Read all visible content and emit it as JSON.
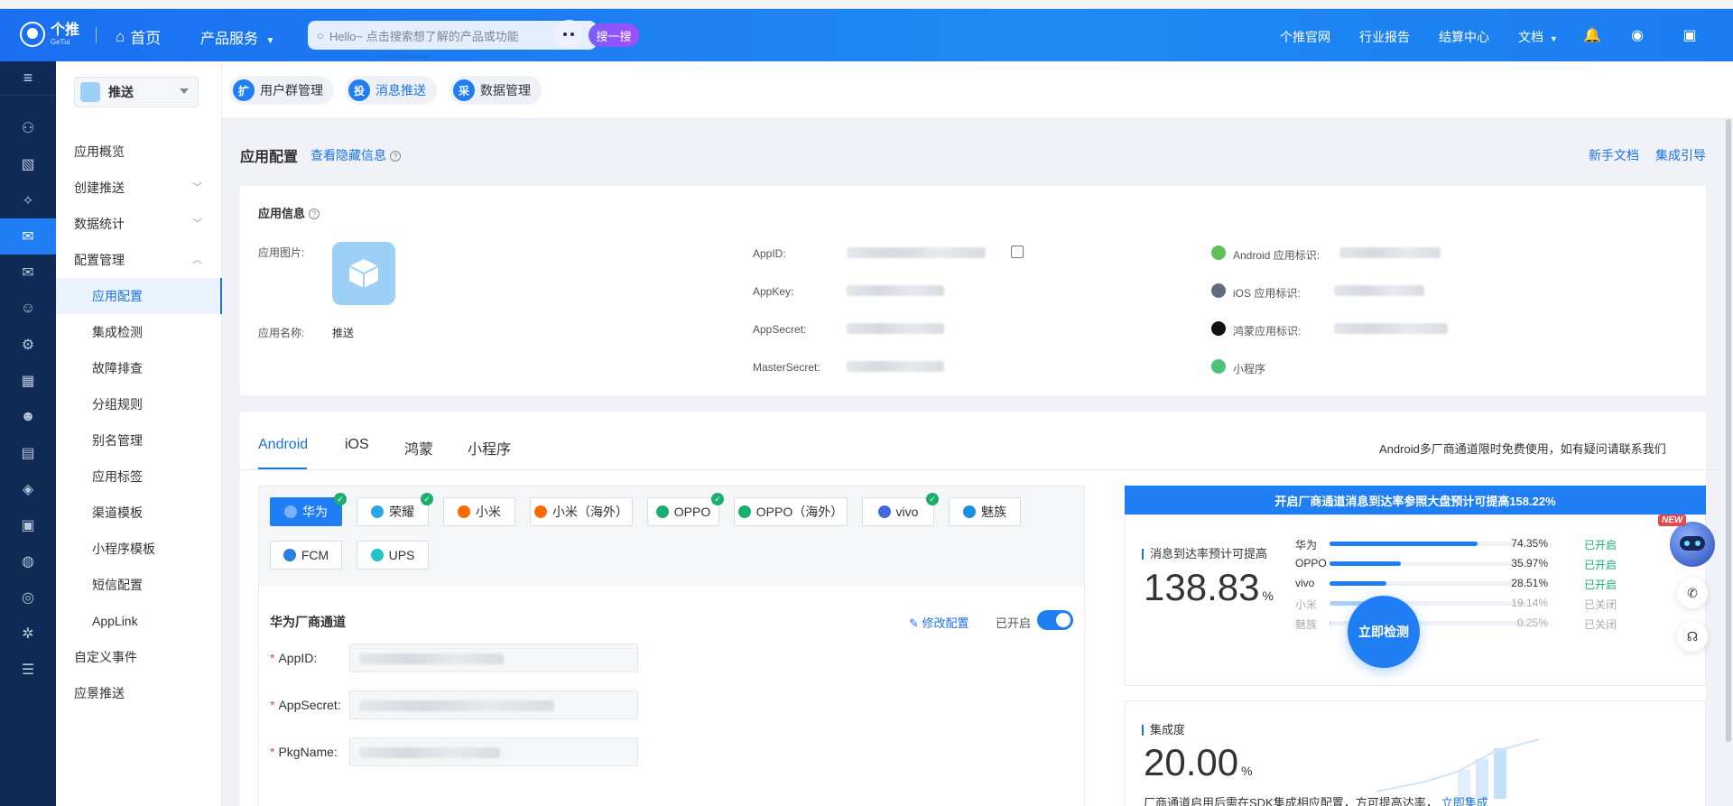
{
  "topnav": {
    "logo_text": "个推",
    "logo_sub": "GeTui",
    "home": "首页",
    "products": "产品服务",
    "search_placeholder": "Hello~ 点击搜索想了解的产品或功能",
    "search_button": "搜一搜",
    "links": [
      "个推官网",
      "行业报告",
      "结算中心",
      "文档"
    ]
  },
  "sidebar": {
    "app_selector": "推送",
    "menu": [
      {
        "label": "应用概览"
      },
      {
        "label": "创建推送"
      },
      {
        "label": "数据统计"
      },
      {
        "label": "配置管理"
      },
      {
        "label": "应用配置"
      },
      {
        "label": "集成检测"
      },
      {
        "label": "故障排查"
      },
      {
        "label": "分组规则"
      },
      {
        "label": "别名管理"
      },
      {
        "label": "应用标签"
      },
      {
        "label": "渠道模板"
      },
      {
        "label": "小程序模板"
      },
      {
        "label": "短信配置"
      },
      {
        "label": "AppLink"
      },
      {
        "label": "自定义事件"
      },
      {
        "label": "应景推送"
      }
    ]
  },
  "tabs": [
    {
      "icon": "扩",
      "label": "用户群管理"
    },
    {
      "icon": "投",
      "label": "消息推送"
    },
    {
      "icon": "采",
      "label": "数据管理"
    }
  ],
  "page": {
    "title": "应用配置",
    "hidden_info_link": "查看隐藏信息",
    "doc_link": "新手文档",
    "guide_link": "集成引导"
  },
  "app_info": {
    "title": "应用信息",
    "image_label": "应用图片:",
    "name_label": "应用名称:",
    "name_value": "推送",
    "appid_label": "AppID:",
    "appkey_label": "AppKey:",
    "appsecret_label": "AppSecret:",
    "mastersecret_label": "MasterSecret:",
    "android_label": "Android 应用标识:",
    "ios_label": "iOS 应用标识:",
    "harmony_label": "鸿蒙应用标识:",
    "miniprogram_label": "小程序"
  },
  "channels": {
    "os_tabs": [
      "Android",
      "iOS",
      "鸿蒙",
      "小程序"
    ],
    "notice": "Android多厂商通道限时免费使用，如有疑问请联系我们",
    "vendors": [
      "华为",
      "荣耀",
      "小米",
      "小米（海外）",
      "OPPO",
      "OPPO（海外）",
      "vivo",
      "魅族",
      "FCM",
      "UPS"
    ],
    "form_title": "华为厂商通道",
    "edit_label": "修改配置",
    "enabled_label": "已开启",
    "fields": [
      "AppID:",
      "AppSecret:",
      "PkgName:"
    ]
  },
  "stats": {
    "banner": "开启厂商通道消息到达率参照大盘预计可提高158.22%",
    "reach_label": "消息到达率预计可提高",
    "reach_value": "138.83",
    "pct_sign": "%",
    "rows": [
      {
        "name": "华为",
        "value": 74.35,
        "value_text": "74.35%",
        "status": "已开启",
        "on": true
      },
      {
        "name": "OPPO",
        "value": 35.97,
        "value_text": "35.97%",
        "status": "已开启",
        "on": true
      },
      {
        "name": "vivo",
        "value": 28.51,
        "value_text": "28.51%",
        "status": "已开启",
        "on": true
      },
      {
        "name": "小米",
        "value": 19.14,
        "value_text": "19.14%",
        "status": "已关闭",
        "on": false
      },
      {
        "name": "魅族",
        "value": 0.25,
        "value_text": "0.25%",
        "status": "已关闭",
        "on": false
      }
    ],
    "integration_label": "集成度",
    "integration_value": "20.00",
    "detect_button": "立即检测",
    "integration_note": "厂商通道启用后需在SDK集成相应配置，方可提高达率，",
    "integration_link": "立即集成"
  },
  "float": {
    "new_tag": "NEW"
  }
}
